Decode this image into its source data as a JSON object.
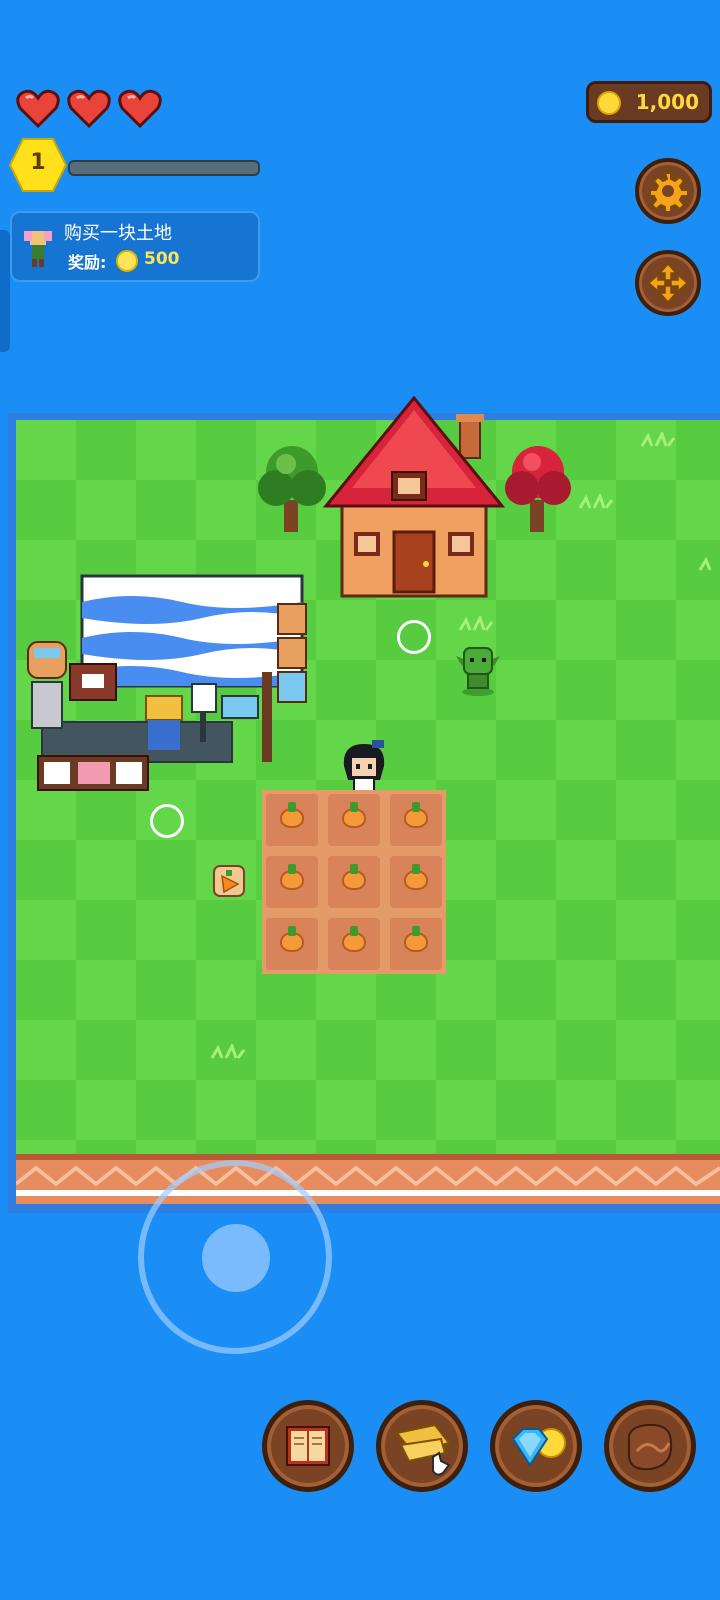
{
  "hud": {
    "hearts": 3,
    "coins": "1,000",
    "level": "1",
    "xp_progress": 0
  },
  "quest": {
    "title": "购买一块土地",
    "reward_label": "奖励:",
    "reward_value": "500"
  },
  "side_buttons": [
    {
      "icon": "gear-icon"
    },
    {
      "icon": "move-arrows-icon"
    }
  ],
  "bottom_buttons": [
    {
      "icon": "book-icon"
    },
    {
      "icon": "map-scroll-icon"
    },
    {
      "icon": "gem-coin-icon"
    },
    {
      "icon": "leather-bag-icon"
    }
  ],
  "colors": {
    "water": "#1a8ef5",
    "grass": "#63d64a",
    "coin": "#ffd93b",
    "button_wood": "#7a4424"
  }
}
